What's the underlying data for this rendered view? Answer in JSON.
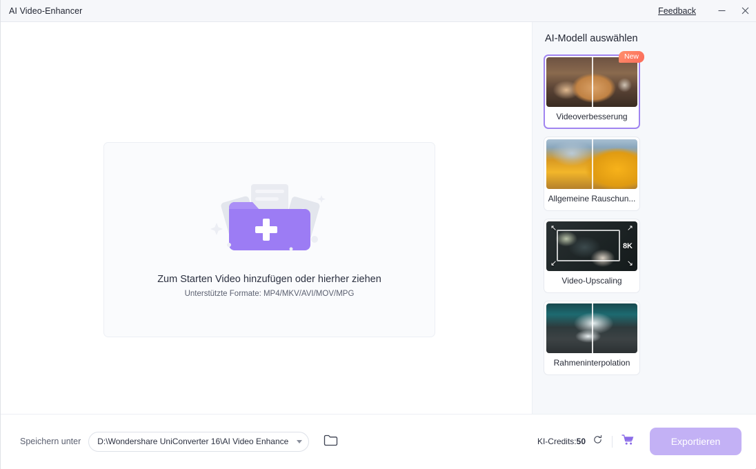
{
  "window": {
    "title": "AI Video-Enhancer",
    "feedback_label": "Feedback",
    "minimize_icon": "minimize-icon",
    "close_icon": "close-icon"
  },
  "dropzone": {
    "title": "Zum Starten Video hinzufügen oder hierher ziehen",
    "subtitle": "Unterstützte Formate: MP4/MKV/AVI/MOV/MPG",
    "icon": "add-folder-icon"
  },
  "right_panel": {
    "title": "AI-Modell auswählen",
    "models": [
      {
        "label": "Videoverbesserung",
        "badge": "New",
        "selected": true,
        "thumb": "dog-photo"
      },
      {
        "label": "Allgemeine Rauschun...",
        "badge": "",
        "selected": false,
        "thumb": "autumn-landscape"
      },
      {
        "label": "Video-Upscaling",
        "badge": "8K",
        "selected": false,
        "thumb": "food-photo"
      },
      {
        "label": "Rahmeninterpolation",
        "badge": "",
        "selected": false,
        "thumb": "drift-car"
      }
    ]
  },
  "bottom_bar": {
    "save_label": "Speichern unter",
    "path_value": "D:\\Wondershare UniConverter 16\\AI Video Enhance",
    "folder_icon": "folder-icon",
    "credits_label": "KI-Credits:",
    "credits_value": "50",
    "refresh_icon": "refresh-icon",
    "cart_icon": "cart-icon",
    "export_label": "Exportieren"
  },
  "colors": {
    "accent": "#a084f0",
    "export_button": "#c3b1f5",
    "badge_new": "#fb6b5a",
    "panel_bg": "#f6f8fb",
    "titlebar_bg": "#f6f7fa"
  }
}
